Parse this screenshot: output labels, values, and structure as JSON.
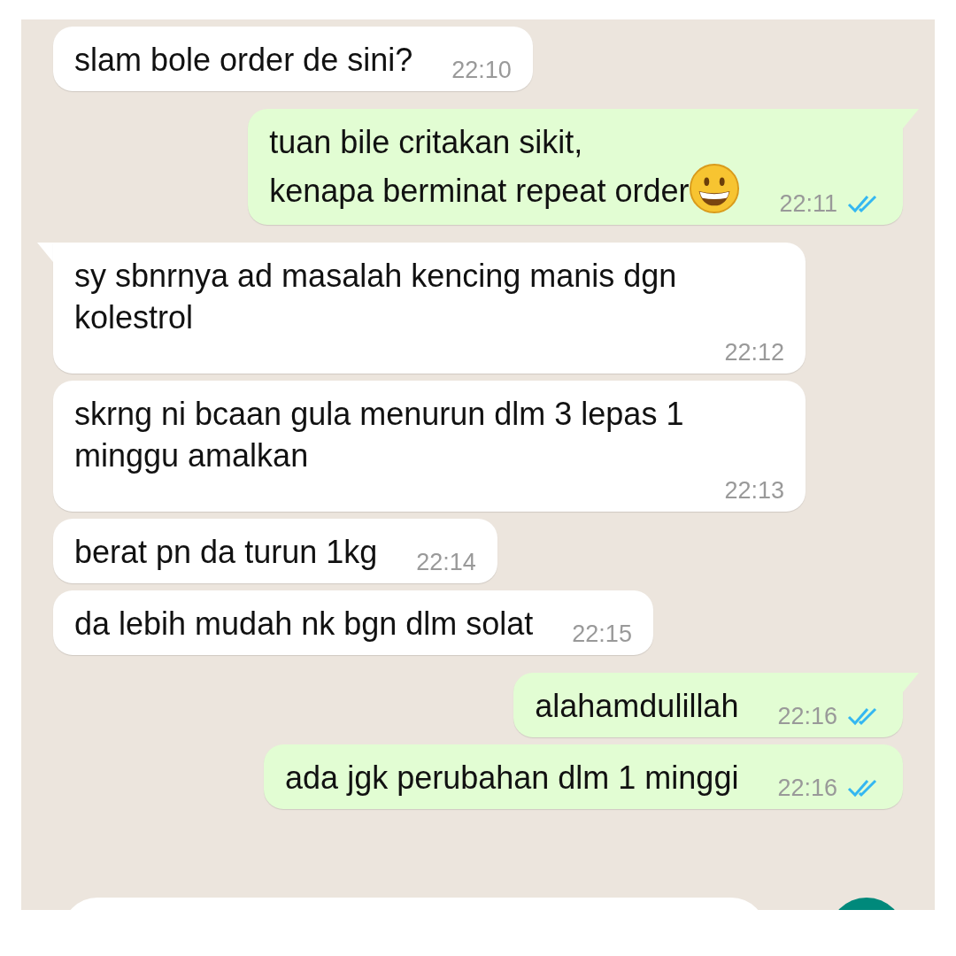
{
  "messages": [
    {
      "outgoing": false,
      "tail": false,
      "emoji": false,
      "text": "slam bole order de sini?",
      "time": "22:10"
    },
    {
      "outgoing": true,
      "tail": true,
      "emoji": true,
      "text": "tuan bile critakan sikit,\nkenapa berminat repeat order",
      "time": "22:11",
      "read": true
    },
    {
      "outgoing": false,
      "tail": true,
      "emoji": false,
      "text": "sy sbnrnya ad masalah kencing manis dgn kolestrol",
      "time": "22:12"
    },
    {
      "outgoing": false,
      "tail": false,
      "emoji": false,
      "text": "skrng ni bcaan gula menurun dlm 3 lepas 1 minggu amalkan",
      "time": "22:13"
    },
    {
      "outgoing": false,
      "tail": false,
      "emoji": false,
      "text": "berat pn da turun 1kg",
      "time": "22:14"
    },
    {
      "outgoing": false,
      "tail": false,
      "emoji": false,
      "text": "da lebih mudah nk bgn dlm solat",
      "time": "22:15"
    },
    {
      "outgoing": true,
      "tail": true,
      "emoji": false,
      "text": "alahamdulillah",
      "time": "22:16",
      "read": true
    },
    {
      "outgoing": true,
      "tail": false,
      "emoji": false,
      "text": "ada jgk perubahan dlm 1 minggi",
      "time": "22:16",
      "read": true
    }
  ]
}
